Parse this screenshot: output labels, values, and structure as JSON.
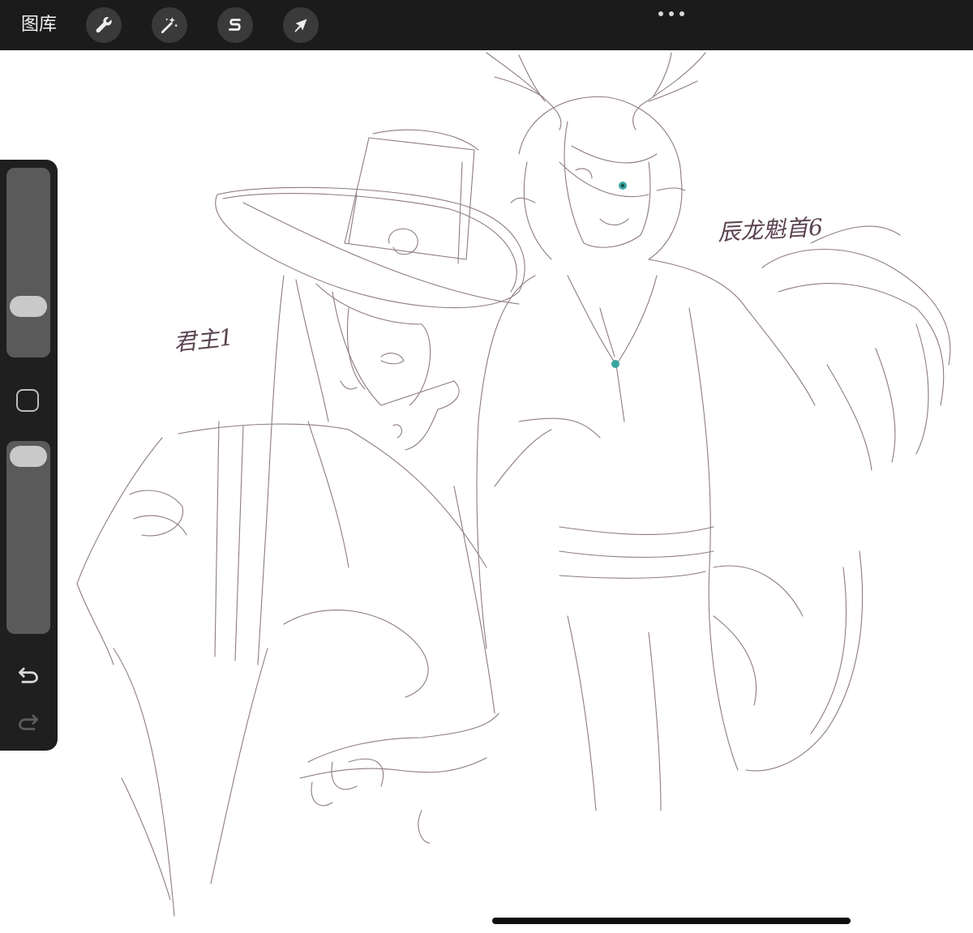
{
  "toolbar": {
    "gallery_label": "图库",
    "tools": [
      {
        "name": "actions",
        "icon": "wrench-icon"
      },
      {
        "name": "adjustments",
        "icon": "magic-wand-icon"
      },
      {
        "name": "selection",
        "icon": "selection-s-icon"
      },
      {
        "name": "transform",
        "icon": "arrow-cursor-icon"
      }
    ],
    "more_icon": "ellipsis-icon"
  },
  "sidebar": {
    "brush_size_slider": {
      "icon": "slider-thumb",
      "level": 0.66
    },
    "modifier_icon": "square-modifier-icon",
    "opacity_slider": {
      "icon": "slider-thumb",
      "level": 0.95
    },
    "undo_icon": "undo-icon",
    "redo_icon": "redo-icon"
  },
  "canvas": {
    "annotations": [
      {
        "text": "君主1"
      },
      {
        "text": "辰龙魁首6"
      }
    ],
    "sketch_color": "#6e5661",
    "eye_color": "#3aa6a0"
  },
  "colors": {
    "toolbar_bg": "#1b1b1b",
    "sidebar_bg": "#1f1f1f",
    "canvas_bg": "#ffffff"
  }
}
